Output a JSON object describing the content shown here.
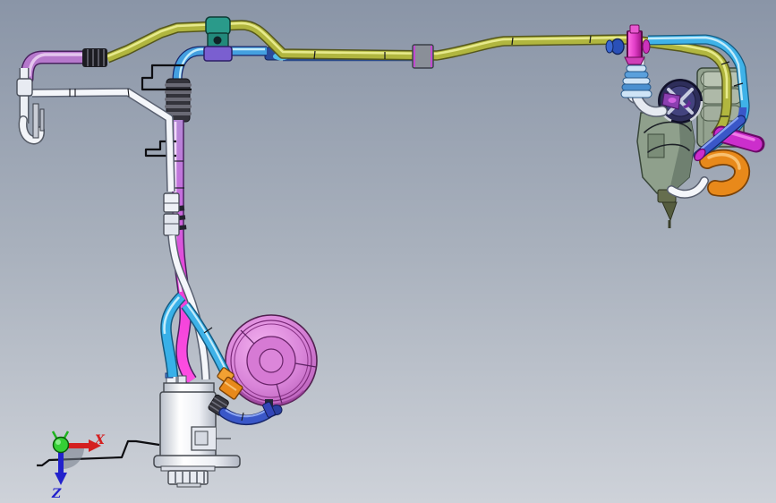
{
  "scene": {
    "type": "3d-cad-viewport",
    "description": "CAD viewport showing an automotive fuel/fluid line assembly: a long yellow-green supply tube with a parallel blue tube across the top, a violet-to-magenta drop tube feeding a white filter canister, a pink circular damper disc, an orange elbow fitting, and a pump/regulator assembly with bellows at the upper right. A reference triad sits at the lower left.",
    "triad": {
      "x_label": "X",
      "z_label": "Z"
    },
    "parts": [
      {
        "name": "yellow-supply-tube",
        "color": "#b3b840"
      },
      {
        "name": "blue-parallel-tube",
        "color": "#3fb2e8"
      },
      {
        "name": "violet-magenta-drop-tube",
        "color": "#e040d8"
      },
      {
        "name": "white-breather-tube",
        "color": "#f4f6fa"
      },
      {
        "name": "tube-clamp-teal",
        "color": "#2a9a8a"
      },
      {
        "name": "tube-clamp-gray",
        "color": "#8a8f98"
      },
      {
        "name": "filter-canister-white",
        "color": "#eef0f5"
      },
      {
        "name": "damper-disc-pink",
        "color": "#d883d8"
      },
      {
        "name": "orange-union-fitting",
        "color": "#e8891a"
      },
      {
        "name": "royal-blue-outlet-tube",
        "color": "#3a57c8"
      },
      {
        "name": "pump-assembly-green",
        "color": "#96a492"
      },
      {
        "name": "pump-face-navy",
        "color": "#2e2e5a"
      },
      {
        "name": "valve-magenta",
        "color": "#e040c0"
      },
      {
        "name": "bellows-blue-white",
        "color": "#5aa0dc"
      },
      {
        "name": "orange-elbow-hose",
        "color": "#e8891a"
      },
      {
        "name": "magenta-stub-hose",
        "color": "#cc2ecc"
      }
    ]
  },
  "colors": {
    "bg_top": "#8a95a7",
    "bg_mid": "#a9b1bd",
    "bg_bottom": "#ced2d9",
    "tube_yellow": "#b1b63f",
    "tube_yellow_hi": "#e7ea8c",
    "tube_yellow_dark": "#55571d",
    "tube_cyan": "#3fb2e8",
    "tube_cyan_hi": "#c2ecfb",
    "tube_cyan_dark": "#155a80",
    "tube_blue": "#3a57c8",
    "tube_blue_hi": "#8aa4f2",
    "tube_blue_dark": "#17266b",
    "violet_dark": "#4a2260",
    "tube_white": "#f4f6fa",
    "tube_white_dark": "#596070",
    "orange": "#e8891a",
    "orange_hi": "#f8c070",
    "orange_dark": "#7a4208",
    "magenta": "#cc2ecc",
    "magenta_dark": "#6a0a66",
    "disc_fill": "#d883d8",
    "disc_dark": "#6a246a",
    "housing_green": "#93a28f",
    "housing_green_dark": "#39473a",
    "pump_navy": "#2e2e5a",
    "pump_purple": "#8b3fb0",
    "clamp_teal": "#2a9a8a",
    "clamp_violet": "#7a5fd0",
    "clamp_gray": "#8a8f98",
    "axis_x": "#d42020",
    "axis_y": "#1fb41f",
    "axis_z": "#2222cc",
    "wire_black": "#0e0e12"
  }
}
